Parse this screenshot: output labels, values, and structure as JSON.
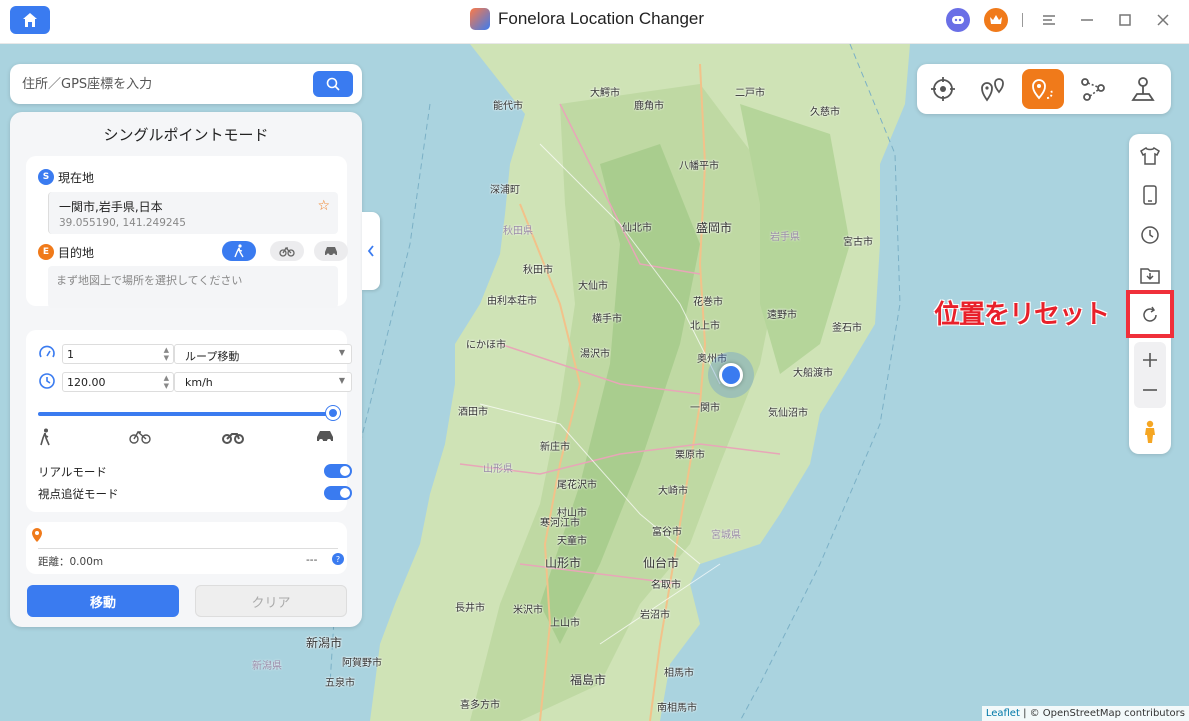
{
  "window": {
    "title": "Fonelora Location Changer"
  },
  "search": {
    "placeholder": "住所／GPS座標を入力"
  },
  "panel": {
    "mode_title": "シングルポイントモード",
    "current": {
      "badge": "S",
      "label": "現在地",
      "address": "一関市,岩手県,日本",
      "coords": "39.055190, 141.249245"
    },
    "destination": {
      "badge": "E",
      "label": "目的地",
      "placeholder": "まず地図上で場所を選択してください"
    },
    "repeat": {
      "value": "1",
      "mode": "ループ移動"
    },
    "speed": {
      "value": "120.00",
      "unit": "km/h",
      "slider_fraction": 1.0
    },
    "toggles": [
      {
        "label": "リアルモード",
        "on": true
      },
      {
        "label": "視点追従モード",
        "on": true
      }
    ],
    "distance": {
      "label": "距離：0.00m",
      "right": "---",
      "help": "?"
    },
    "go_label": "移動",
    "clear_label": "クリア"
  },
  "annotation": {
    "reset_label": "位置をリセット",
    "color": "#e8202a"
  },
  "map": {
    "attribution_leaflet": "Leaflet",
    "attribution_rest": "| © OpenStreetMap contributors",
    "prefectures": [
      "秋田県",
      "岩手県",
      "山形県",
      "宮城県",
      "新潟県"
    ],
    "cities": [
      "大鰐市",
      "鹿角市",
      "二戸市",
      "久慈市",
      "能代市",
      "八幡平市",
      "深浦町",
      "秋田市",
      "盛岡市",
      "宮古市",
      "仙北市",
      "由利本荘市",
      "大仙市",
      "花巻市",
      "遠野市",
      "釜石市",
      "横手市",
      "北上市",
      "にかほ市",
      "湯沢市",
      "奥州市",
      "大船渡市",
      "酒田市",
      "一関市",
      "気仙沼市",
      "新庄市",
      "栗原市",
      "尾花沢市",
      "大崎市",
      "村山市",
      "天童市",
      "富谷市",
      "山形市",
      "仙台市",
      "名取市",
      "米沢市",
      "新潟市",
      "阿賀野市",
      "五泉市",
      "福島市",
      "喜多方市",
      "南相馬市",
      "相馬市",
      "上山市",
      "岩沼市",
      "寒河江市",
      "長井市"
    ]
  },
  "colors": {
    "accent": "#3a7bf0",
    "highlight": "#f07a1a"
  }
}
